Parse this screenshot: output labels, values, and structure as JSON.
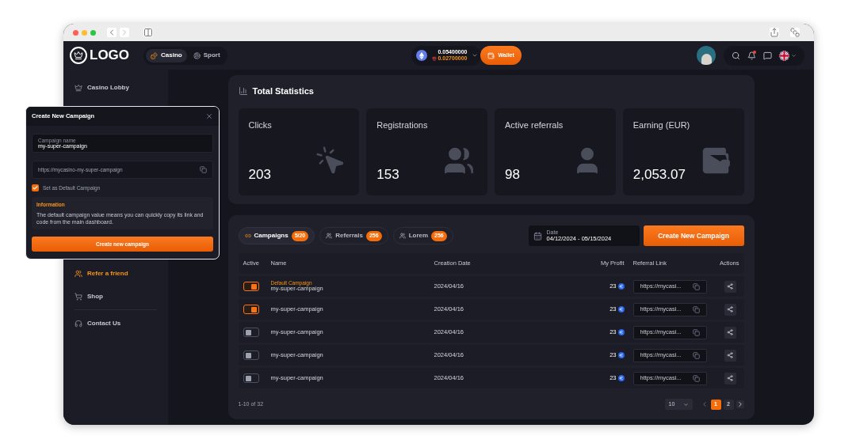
{
  "header": {
    "logo": "LOGO",
    "nav": [
      {
        "label": "Casino",
        "selected": true
      },
      {
        "label": "Sport",
        "selected": false
      }
    ],
    "balance": "0.05400000",
    "bonus": "0.02700000",
    "wallet": "Wallet",
    "has_notification": true
  },
  "sidebar": {
    "items": [
      {
        "label": "Casino Lobby",
        "selected": false
      },
      {
        "label": "Refer a friend",
        "selected": true
      },
      {
        "label": "Shop",
        "selected": false
      }
    ],
    "support_items": [
      {
        "label": "Contact Us",
        "selected": false
      }
    ]
  },
  "stats": {
    "title": "Total Statistics",
    "cards": [
      {
        "label": "Clicks",
        "value": "203"
      },
      {
        "label": "Registrations",
        "value": "153"
      },
      {
        "label": "Active referrals",
        "value": "98"
      },
      {
        "label": "Earning (EUR)",
        "value": "2,053.07"
      }
    ]
  },
  "campaigns": {
    "tabs": [
      {
        "label": "Campaigns",
        "count": "5/20",
        "selected": true
      },
      {
        "label": "Referrals",
        "count": "256",
        "selected": false
      },
      {
        "label": "Lorem",
        "count": "256",
        "selected": false
      }
    ],
    "date": {
      "label": "Date",
      "value": "04/12/2024 - 05/15/2024"
    },
    "create_button": "Create New Campaign",
    "columns": [
      "Active",
      "Name",
      "Creation Date",
      "My Profit",
      "Referral Link",
      "Actions"
    ],
    "rows": [
      {
        "active": true,
        "tag": "Default Campaign",
        "name": "my-super-campaign",
        "date": "2024/04/16",
        "profit": "23",
        "link": "https://mycasi..."
      },
      {
        "active": true,
        "name": "my-super-campaign",
        "date": "2024/04/16",
        "profit": "23",
        "link": "https://mycasi..."
      },
      {
        "active": false,
        "name": "my-super-campaign",
        "date": "2024/04/16",
        "profit": "23",
        "link": "https://mycasi..."
      },
      {
        "active": false,
        "name": "my-super-campaign",
        "date": "2024/04/16",
        "profit": "23",
        "link": "https://mycasi..."
      },
      {
        "active": false,
        "name": "my-super-campaign",
        "date": "2024/04/16",
        "profit": "23",
        "link": "https://mycasi..."
      }
    ],
    "range": "1-10 of 32",
    "page_size": "10",
    "pages": [
      {
        "label": "1",
        "selected": true
      },
      {
        "label": "2",
        "selected": false
      }
    ]
  },
  "modal": {
    "title": "Create New Campaign",
    "name_field": {
      "label": "Campaign name",
      "value": "my-super-campaign"
    },
    "url_field": {
      "value": "https://mycasino-my-super-campaign"
    },
    "default_checkbox": {
      "label": "Set as Default Campaign",
      "checked": true
    },
    "info": {
      "title": "Information",
      "text": "The default campaign value means you can quickly copy its link and code from the main dashboard."
    },
    "submit": "Create new campaign"
  }
}
